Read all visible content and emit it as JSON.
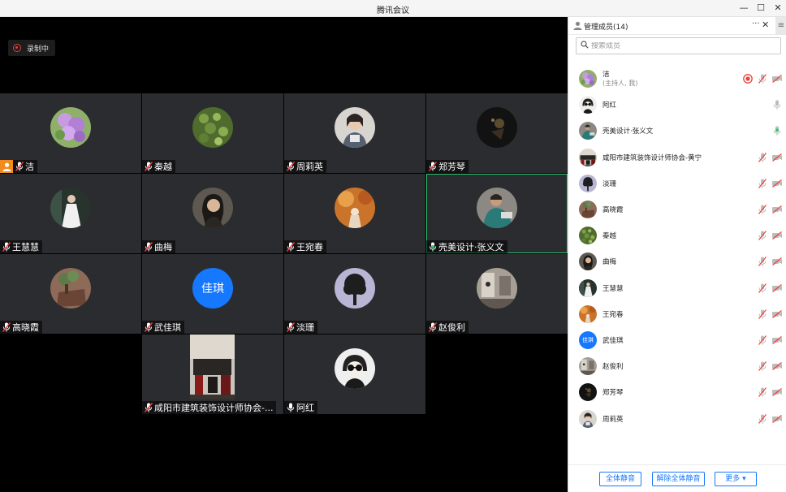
{
  "window": {
    "title": "腾讯会议",
    "controls": [
      "—",
      "☐",
      "✕"
    ]
  },
  "recording": {
    "label": "录制中"
  },
  "tiles": [
    {
      "name": "洁",
      "host": true,
      "mic": "muted",
      "avatar": "flower-purple"
    },
    {
      "name": "秦越",
      "mic": "muted",
      "avatar": "leaves-green"
    },
    {
      "name": "周莉英",
      "mic": "muted",
      "avatar": "person-light"
    },
    {
      "name": "郑芳琴",
      "mic": "muted",
      "avatar": "dark-photo"
    },
    {
      "name": "王慧慧",
      "mic": "muted",
      "avatar": "person-white-dress"
    },
    {
      "name": "曲梅",
      "mic": "muted",
      "avatar": "person-dark-hair"
    },
    {
      "name": "王宛春",
      "mic": "muted",
      "avatar": "autumn-orange"
    },
    {
      "name": "壳美设计·张义文",
      "mic": "on",
      "active": true,
      "avatar": "person-teal"
    },
    {
      "name": "高晓霞",
      "mic": "muted",
      "avatar": "plant-brown"
    },
    {
      "name": "武佳琪",
      "mic": "muted",
      "avatar_text": "佳琪"
    },
    {
      "name": "淡珊",
      "mic": "muted",
      "avatar": "tree-silhouette"
    },
    {
      "name": "赵俊利",
      "mic": "muted",
      "avatar": "room-grey"
    },
    {
      "name": "咸阳市建筑装饰设计师协会-...",
      "mic": "muted",
      "avatar": "photo-room"
    },
    {
      "name": "阿红",
      "mic": "on",
      "avatar": "sunglasses-person"
    }
  ],
  "panel": {
    "title": "管理成员(14)",
    "search_placeholder": "搜索成员",
    "members": [
      {
        "name": "洁",
        "role": "(主持人, 我)",
        "icons": [
          "record",
          "mic-muted",
          "cam-off"
        ],
        "avatar": "flower-purple"
      },
      {
        "name": "阿红",
        "icons": [
          "mic-on"
        ],
        "avatar": "sunglasses-person"
      },
      {
        "name": "壳美设计·张义文",
        "icons": [
          "mic-speaking"
        ],
        "avatar": "person-teal"
      },
      {
        "name": "咸阳市建筑装饰设计师协会-黄宁",
        "icons": [
          "mic-muted",
          "cam-off"
        ],
        "avatar": "photo-room"
      },
      {
        "name": "淡珊",
        "icons": [
          "mic-muted",
          "cam-off"
        ],
        "avatar": "tree-silhouette"
      },
      {
        "name": "高晓霞",
        "icons": [
          "mic-muted",
          "cam-off"
        ],
        "avatar": "plant-brown"
      },
      {
        "name": "秦越",
        "icons": [
          "mic-muted",
          "cam-off"
        ],
        "avatar": "leaves-green"
      },
      {
        "name": "曲梅",
        "icons": [
          "mic-muted",
          "cam-off"
        ],
        "avatar": "person-dark-hair"
      },
      {
        "name": "王慧慧",
        "icons": [
          "mic-muted",
          "cam-off"
        ],
        "avatar": "person-white-dress"
      },
      {
        "name": "王宛春",
        "icons": [
          "mic-muted",
          "cam-off"
        ],
        "avatar": "autumn-orange"
      },
      {
        "name": "武佳琪",
        "avatar_text": "佳琪",
        "icons": [
          "mic-muted",
          "cam-off"
        ]
      },
      {
        "name": "赵俊利",
        "icons": [
          "mic-muted",
          "cam-off"
        ],
        "avatar": "room-grey"
      },
      {
        "name": "郑芳琴",
        "icons": [
          "mic-muted",
          "cam-off"
        ],
        "avatar": "dark-photo"
      },
      {
        "name": "周莉英",
        "icons": [
          "mic-muted",
          "cam-off"
        ],
        "avatar": "person-light"
      }
    ],
    "buttons": {
      "mute_all": "全体静音",
      "unmute_all": "解除全体静音",
      "more": "更多 ▾"
    }
  },
  "colors": {
    "accent": "#1677ff",
    "active_border": "#2ecc71",
    "record": "#e8413a",
    "host_badge": "#f28b1d",
    "tile_bg": "#2b2c2f"
  }
}
